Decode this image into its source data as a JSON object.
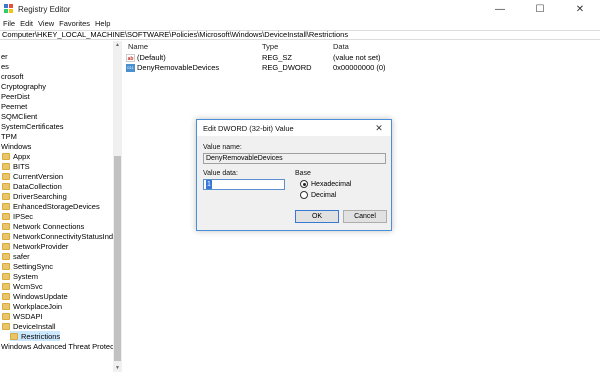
{
  "window": {
    "title": "Registry Editor",
    "controls": {
      "minimize": "—",
      "maximize": "☐",
      "close": "✕"
    },
    "icon_colors": [
      "#3a78d6",
      "#e74c3c",
      "#2ecc71",
      "#f1c40f"
    ]
  },
  "menu": [
    "File",
    "Edit",
    "View",
    "Favorites",
    "Help"
  ],
  "address": "Computer\\HKEY_LOCAL_MACHINE\\SOFTWARE\\Policies\\Microsoft\\Windows\\DeviceInstall\\Restrictions",
  "tree": {
    "items": [
      {
        "label": "er",
        "folder": false,
        "selected": false
      },
      {
        "label": "es",
        "folder": false,
        "selected": false
      },
      {
        "label": "crosoft",
        "folder": false,
        "selected": false
      },
      {
        "label": "Cryptography",
        "folder": false,
        "selected": false
      },
      {
        "label": "PeerDist",
        "folder": false,
        "selected": false
      },
      {
        "label": "Peernet",
        "folder": false,
        "selected": false
      },
      {
        "label": "SQMClient",
        "folder": false,
        "selected": false
      },
      {
        "label": "SystemCertificates",
        "folder": false,
        "selected": false
      },
      {
        "label": "TPM",
        "folder": false,
        "selected": false
      },
      {
        "label": "Windows",
        "folder": false,
        "selected": false
      },
      {
        "label": "Appx",
        "folder": true,
        "selected": false
      },
      {
        "label": "BITS",
        "folder": true,
        "selected": false
      },
      {
        "label": "CurrentVersion",
        "folder": true,
        "selected": false
      },
      {
        "label": "DataCollection",
        "folder": true,
        "selected": false
      },
      {
        "label": "DriverSearching",
        "folder": true,
        "selected": false
      },
      {
        "label": "EnhancedStorageDevices",
        "folder": true,
        "selected": false
      },
      {
        "label": "IPSec",
        "folder": true,
        "selected": false
      },
      {
        "label": "Network Connections",
        "folder": true,
        "selected": false
      },
      {
        "label": "NetworkConnectivityStatusIndic",
        "folder": true,
        "selected": false
      },
      {
        "label": "NetworkProvider",
        "folder": true,
        "selected": false
      },
      {
        "label": "safer",
        "folder": true,
        "selected": false
      },
      {
        "label": "SettingSync",
        "folder": true,
        "selected": false
      },
      {
        "label": "System",
        "folder": true,
        "selected": false
      },
      {
        "label": "WcmSvc",
        "folder": true,
        "selected": false
      },
      {
        "label": "WindowsUpdate",
        "folder": true,
        "selected": false
      },
      {
        "label": "WorkplaceJoin",
        "folder": true,
        "selected": false
      },
      {
        "label": "WSDAPI",
        "folder": true,
        "selected": false
      },
      {
        "label": "DeviceInstall",
        "folder": true,
        "selected": false
      },
      {
        "label": "Restrictions",
        "folder": true,
        "selected": true
      },
      {
        "label": "Windows Advanced Threat Protectio",
        "folder": false,
        "selected": false
      }
    ]
  },
  "list": {
    "columns": {
      "name": "Name",
      "type": "Type",
      "data": "Data"
    },
    "rows": [
      {
        "icon": "string-value-icon",
        "glyph": "ab",
        "name": "(Default)",
        "type": "REG_SZ",
        "data": "(value not set)"
      },
      {
        "icon": "binary-value-icon",
        "glyph": "011",
        "name": "DenyRemovableDevices",
        "type": "REG_DWORD",
        "data": "0x00000000 (0)"
      }
    ]
  },
  "dialog": {
    "title": "Edit DWORD (32-bit) Value",
    "close": "✕",
    "value_name_label": "Value name:",
    "value_name": "DenyRemovableDevices",
    "value_data_label": "Value data:",
    "value_data": "1",
    "base_label": "Base",
    "radio_hex": "Hexadecimal",
    "radio_dec": "Decimal",
    "ok": "OK",
    "cancel": "Cancel"
  }
}
